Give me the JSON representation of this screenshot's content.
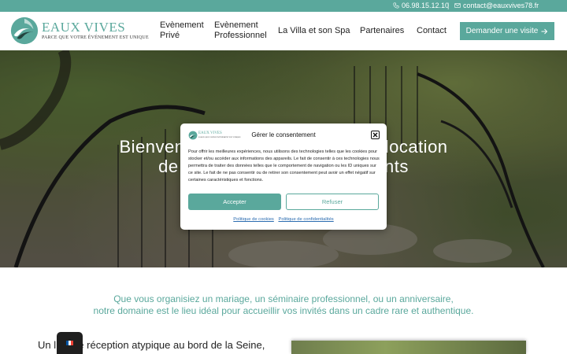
{
  "topbar": {
    "phone": "06.98.15.12.10",
    "separator": "|",
    "email": "contact@eauxvives78.fr",
    "phone_icon": "phone-icon",
    "email_icon": "mail-icon"
  },
  "brand": {
    "name": "EAUX VIVES",
    "tagline": "PARCE QUE VOTRE ÉVÉNEMENT EST UNIQUE",
    "accent": "#5aa89c"
  },
  "nav": {
    "items": [
      {
        "line1": "Evènement",
        "line2": "Privé"
      },
      {
        "line1": "Evènement",
        "line2": "Professionnel"
      },
      {
        "label": "La Villa et son Spa"
      },
      {
        "label": "Partenaires"
      },
      {
        "label": "Contact"
      }
    ],
    "cta_label": "Demander une visite",
    "cta_icon": "arrow-right-icon"
  },
  "hero": {
    "line1": "Bienvenue à Eaux Vives, lieu de location",
    "line2": "de salles pour vos événements"
  },
  "intro": {
    "line1": "Que vous organisiez un mariage, un séminaire professionnel, ou un anniversaire,",
    "line2": "notre domaine est le lieu idéal pour accueillir vos invités dans un cadre rare et authentique."
  },
  "lower": {
    "text": "Un lieu de réception atypique au bord de la Seine,"
  },
  "language": {
    "code": "fr",
    "flag_colors": [
      "#0055a4",
      "#ffffff",
      "#ef4135"
    ]
  },
  "consent": {
    "title": "Gérer le consentement",
    "close_icon": "close-icon",
    "body": "Pour offrir les meilleures expériences, nous utilisons des technologies telles que les cookies pour stocker et/ou accéder aux informations des appareils. Le fait de consentir à ces technologies nous permettra de traiter des données telles que le comportement de navigation ou les ID uniques sur ce site. Le fait de ne pas consentir ou de retirer son consentement peut avoir un effet négatif sur certaines caractéristiques et fonctions.",
    "accept_label": "Accepter",
    "refuse_label": "Refuser",
    "cookie_policy_label": "Politique de cookies",
    "privacy_policy_label": "Politique de confidentialités"
  }
}
